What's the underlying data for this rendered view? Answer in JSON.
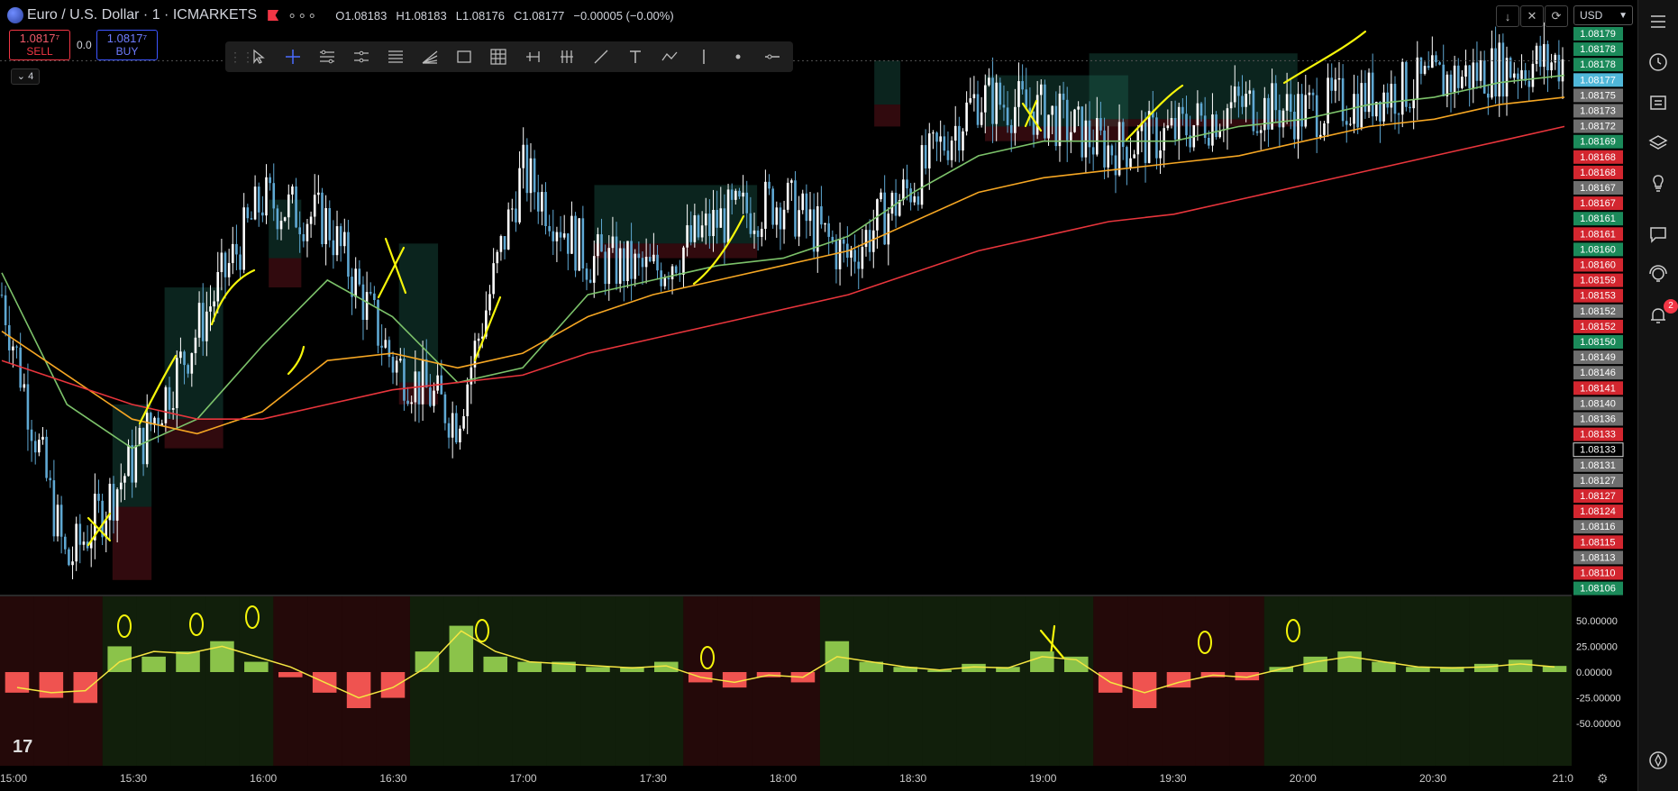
{
  "header": {
    "symbol": "Euro / U.S. Dollar · 1 · ICMARKETS",
    "open_label": "O",
    "open": "1.08183",
    "high_label": "H",
    "high": "1.08183",
    "low_label": "L",
    "low": "1.08176",
    "close_label": "C",
    "close": "1.08177",
    "change": "−0.00005 (−0.00%)",
    "menu_dots": "∘∘∘"
  },
  "trade": {
    "sell_price": "1.0817⁷",
    "sell_label": "SELL",
    "buy_price": "1.0817⁷",
    "buy_label": "BUY",
    "spread": "0.0"
  },
  "indicators_count": "4",
  "currency": "USD",
  "notification_count": "2",
  "colors": {
    "up": "#26a69a",
    "down": "#ef5350",
    "candle_up": "#ffffff",
    "candle_down": "#5fa8d3",
    "ema_fast": "#7cc26a",
    "ema_mid": "#f5a623",
    "ema_slow": "#e8353c",
    "annotation": "#f5f50a"
  },
  "chart_data": [
    {
      "type": "candlestick",
      "title": "Euro / U.S. Dollar · 1 · ICMARKETS",
      "x_ticks": [
        "15:00",
        "15:30",
        "16:00",
        "16:30",
        "17:00",
        "17:30",
        "18:00",
        "18:30",
        "19:00",
        "19:30",
        "20:00",
        "20:30",
        "21:0"
      ],
      "y_ticks": [
        "1.08179",
        "1.08178",
        "1.08178",
        "1.08177",
        "1.08175",
        "1.08173",
        "1.08172",
        "1.08169",
        "1.08168",
        "1.08168",
        "1.08167",
        "1.08167",
        "1.08161",
        "1.08161",
        "1.08160",
        "1.08160",
        "1.08159",
        "1.08153",
        "1.08152",
        "1.08152",
        "1.08150",
        "1.08149",
        "1.08146",
        "1.08141",
        "1.08140",
        "1.08136",
        "1.08133",
        "1.08133",
        "1.08131",
        "1.08127",
        "1.08127",
        "1.08124",
        "1.08116",
        "1.08115",
        "1.08113",
        "1.08110",
        "1.08106"
      ],
      "y_tick_colors": [
        "green",
        "green",
        "green",
        "cyan",
        "gray",
        "gray",
        "gray",
        "green",
        "red",
        "red",
        "gray",
        "red",
        "green",
        "red",
        "green",
        "red",
        "red",
        "red",
        "gray",
        "red",
        "green",
        "gray",
        "gray",
        "red",
        "gray",
        "gray",
        "red",
        "white",
        "gray",
        "gray",
        "red",
        "red",
        "gray",
        "red",
        "gray",
        "red",
        "green"
      ],
      "ylim": [
        1.08104,
        1.0818
      ],
      "current_price": 1.08177,
      "series": [
        {
          "name": "close",
          "x": [
            "15:00",
            "15:15",
            "15:30",
            "15:45",
            "16:00",
            "16:15",
            "16:30",
            "16:45",
            "17:00",
            "17:15",
            "17:30",
            "17:45",
            "18:00",
            "18:15",
            "18:30",
            "18:45",
            "19:00",
            "19:15",
            "19:30",
            "19:45",
            "20:00",
            "20:15",
            "20:30",
            "20:45",
            "21:00"
          ],
          "values": [
            1.08145,
            1.08108,
            1.08122,
            1.0814,
            1.08158,
            1.08155,
            1.08136,
            1.08128,
            1.08162,
            1.0815,
            1.08148,
            1.08155,
            1.08158,
            1.0815,
            1.0816,
            1.08172,
            1.0817,
            1.08165,
            1.08167,
            1.08171,
            1.0817,
            1.08172,
            1.08174,
            1.08176,
            1.08177
          ]
        },
        {
          "name": "ema_fast",
          "values": [
            1.08148,
            1.0813,
            1.08124,
            1.08128,
            1.08138,
            1.08147,
            1.08142,
            1.08133,
            1.08135,
            1.08145,
            1.08147,
            1.08149,
            1.0815,
            1.08153,
            1.08159,
            1.08164,
            1.08166,
            1.08166,
            1.08166,
            1.08168,
            1.08169,
            1.08171,
            1.08172,
            1.08174,
            1.08175
          ]
        },
        {
          "name": "ema_mid",
          "values": [
            1.0814,
            1.08134,
            1.08128,
            1.08126,
            1.08129,
            1.08136,
            1.08137,
            1.08135,
            1.08137,
            1.08142,
            1.08145,
            1.08147,
            1.08149,
            1.08151,
            1.08155,
            1.08159,
            1.08161,
            1.08162,
            1.08163,
            1.08164,
            1.08166,
            1.08168,
            1.08169,
            1.08171,
            1.08172
          ]
        },
        {
          "name": "ema_slow",
          "values": [
            1.08136,
            1.08133,
            1.0813,
            1.08128,
            1.08128,
            1.0813,
            1.08132,
            1.08133,
            1.08134,
            1.08137,
            1.08139,
            1.08141,
            1.08143,
            1.08145,
            1.08148,
            1.08151,
            1.08153,
            1.08155,
            1.08156,
            1.08158,
            1.0816,
            1.08162,
            1.08164,
            1.08166,
            1.08168
          ]
        }
      ]
    },
    {
      "type": "bar",
      "y_ticks": [
        "50.00000",
        "25.00000",
        "0.00000",
        "-25.00000",
        "-50.00000"
      ],
      "ylim": [
        -70,
        70
      ],
      "series": [
        {
          "name": "histogram",
          "values": [
            -20,
            -25,
            -30,
            25,
            15,
            20,
            30,
            10,
            -5,
            -20,
            -35,
            -25,
            20,
            45,
            15,
            10,
            10,
            5,
            5,
            10,
            -10,
            -15,
            -5,
            -10,
            30,
            10,
            5,
            2,
            8,
            5,
            20,
            15,
            -20,
            -35,
            -15,
            -5,
            -8,
            5,
            15,
            20,
            10,
            5,
            5,
            8,
            12,
            6
          ]
        },
        {
          "name": "signal",
          "values": [
            -15,
            -20,
            -18,
            10,
            20,
            18,
            25,
            15,
            5,
            -10,
            -25,
            -15,
            5,
            40,
            20,
            10,
            8,
            6,
            4,
            6,
            -5,
            -10,
            -3,
            -5,
            15,
            10,
            5,
            2,
            5,
            4,
            15,
            12,
            -10,
            -20,
            -10,
            -3,
            -5,
            3,
            10,
            15,
            10,
            5,
            4,
            5,
            8,
            5
          ]
        }
      ]
    }
  ]
}
